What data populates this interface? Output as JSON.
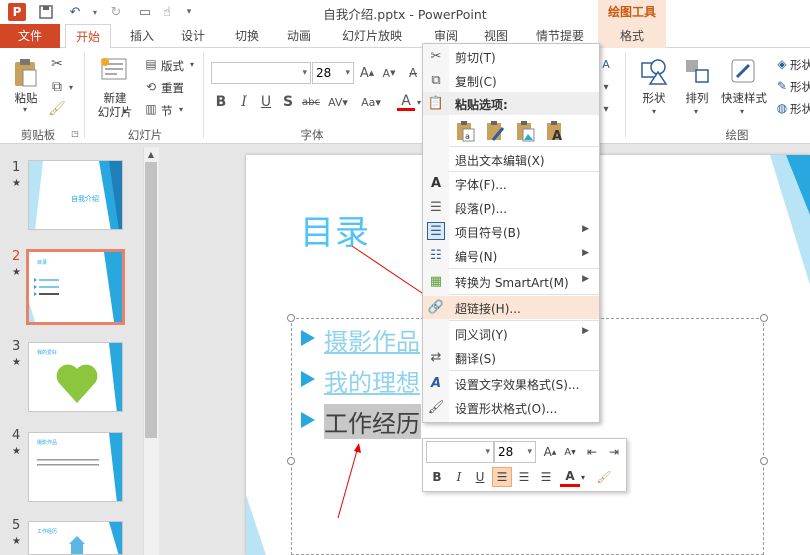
{
  "window": {
    "title": "自我介绍.pptx - PowerPoint",
    "contextual_group": "绘图工具"
  },
  "tabs": [
    "文件",
    "开始",
    "插入",
    "设计",
    "切换",
    "动画",
    "幻灯片放映",
    "审阅",
    "视图",
    "情节提要",
    "格式"
  ],
  "ribbon": {
    "clipboard": {
      "paste": "粘贴",
      "label": "剪贴板"
    },
    "slides": {
      "new_slide_line1": "新建",
      "new_slide_line2": "幻灯片",
      "layout": "版式",
      "reset": "重置",
      "section": "节",
      "label": "幻灯片"
    },
    "font": {
      "font_name": "",
      "font_size": "28",
      "label": "字体"
    },
    "drawing": {
      "shape": "形状",
      "arrange": "排列",
      "quick_styles": "快速样式",
      "label": "绘图",
      "fill": "形状",
      "outline": "形状",
      "effects": "形状"
    }
  },
  "thumbnails": [
    {
      "num": "1",
      "title": "自我介绍"
    },
    {
      "num": "2",
      "title": "目录"
    },
    {
      "num": "3",
      "title": "我的爱好"
    },
    {
      "num": "4",
      "title": "摄影作品"
    },
    {
      "num": "5",
      "title": "工作经历"
    }
  ],
  "slide": {
    "title": "目录",
    "bullets": [
      "摄影作品",
      "我的理想",
      "工作经历"
    ]
  },
  "context_menu": {
    "items": [
      {
        "label": "剪切(T)",
        "icon": "scissors-icon"
      },
      {
        "label": "复制(C)",
        "icon": "copy-icon"
      },
      {
        "label": "粘贴选项:",
        "icon": "paste-icon",
        "header": true
      },
      {
        "label": "退出文本编辑(X)"
      },
      {
        "label": "字体(F)...",
        "icon": "font-icon"
      },
      {
        "label": "段落(P)...",
        "icon": "paragraph-icon"
      },
      {
        "label": "项目符号(B)",
        "icon": "bullets-icon",
        "submenu": true
      },
      {
        "label": "编号(N)",
        "icon": "numbering-icon",
        "submenu": true
      },
      {
        "label": "转换为 SmartArt(M)",
        "icon": "smartart-icon",
        "submenu": true
      },
      {
        "label": "超链接(H)...",
        "icon": "hyperlink-icon",
        "highlighted": true
      },
      {
        "label": "同义词(Y)",
        "submenu": true
      },
      {
        "label": "翻译(S)",
        "icon": "translate-icon"
      },
      {
        "label": "设置文字效果格式(S)...",
        "icon": "text-effects-icon"
      },
      {
        "label": "设置形状格式(O)...",
        "icon": "shape-format-icon"
      }
    ]
  },
  "mini_toolbar": {
    "font_name": "",
    "font_size": "28",
    "buttons": [
      "B",
      "I",
      "U"
    ]
  },
  "colors": {
    "accent": "#d24726",
    "highlight": "#fbe5d6",
    "slide_blue": "#29a8e0"
  }
}
